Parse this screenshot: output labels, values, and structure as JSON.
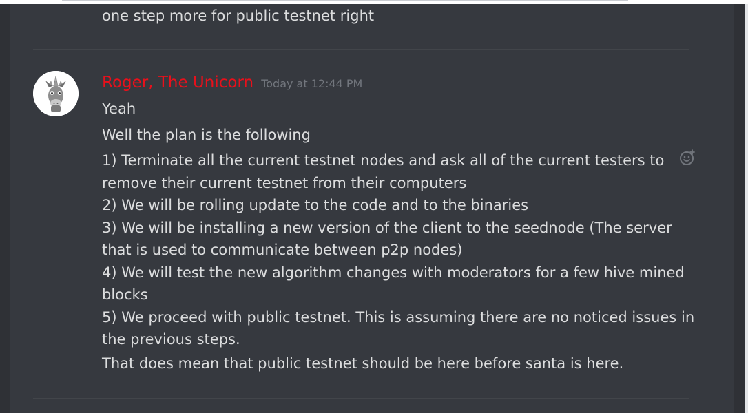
{
  "previous_message": {
    "text": "one step more for public testnet right"
  },
  "message": {
    "author": "Roger, The Unicorn",
    "author_color": "#e8101b",
    "timestamp": "Today at 12:44 PM",
    "avatar_icon": "unicorn-avatar-icon",
    "lines": [
      "Yeah",
      "Well the plan is the following"
    ],
    "plan_steps": [
      "1) Terminate all the current testnet nodes and ask all of the current testers to remove their current testnet from their computers",
      "2) We will be rolling update to the code and to the binaries",
      "3) We will be installing a new version of the client to the seednode (The server that is used to communicate between p2p nodes)",
      "4)  We will test the new algorithm changes with moderators for a few hive mined blocks",
      "5) We proceed with public testnet. This is assuming there are no noticed issues in the previous steps."
    ],
    "closing": "That does mean that public testnet should be here before santa is here."
  },
  "actions": {
    "add_reaction_icon": "add-reaction-icon"
  },
  "colors": {
    "background": "#36393f",
    "text": "#dcddde",
    "muted": "#72767d"
  }
}
